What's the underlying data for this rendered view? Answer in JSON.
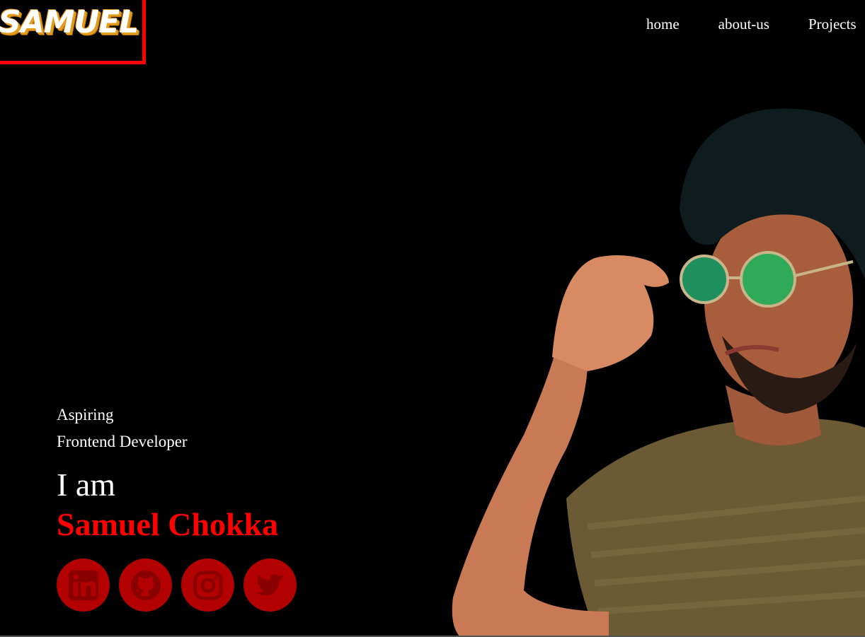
{
  "logo": {
    "text": "SAMUEL"
  },
  "nav": {
    "items": [
      {
        "label": "home"
      },
      {
        "label": "about-us"
      },
      {
        "label": "Projects"
      }
    ]
  },
  "hero": {
    "subtitle_line1": "Aspiring",
    "subtitle_line2": "Frontend Developer",
    "intro": "I am",
    "name": "Samuel Chokka"
  },
  "socials": [
    {
      "name": "linkedin-icon"
    },
    {
      "name": "github-icon"
    },
    {
      "name": "instagram-icon"
    },
    {
      "name": "twitter-icon"
    }
  ],
  "colors": {
    "accent": "#ff0000",
    "icon_bg": "#b30000",
    "icon_fg": "#8a0000",
    "background": "#000000"
  }
}
